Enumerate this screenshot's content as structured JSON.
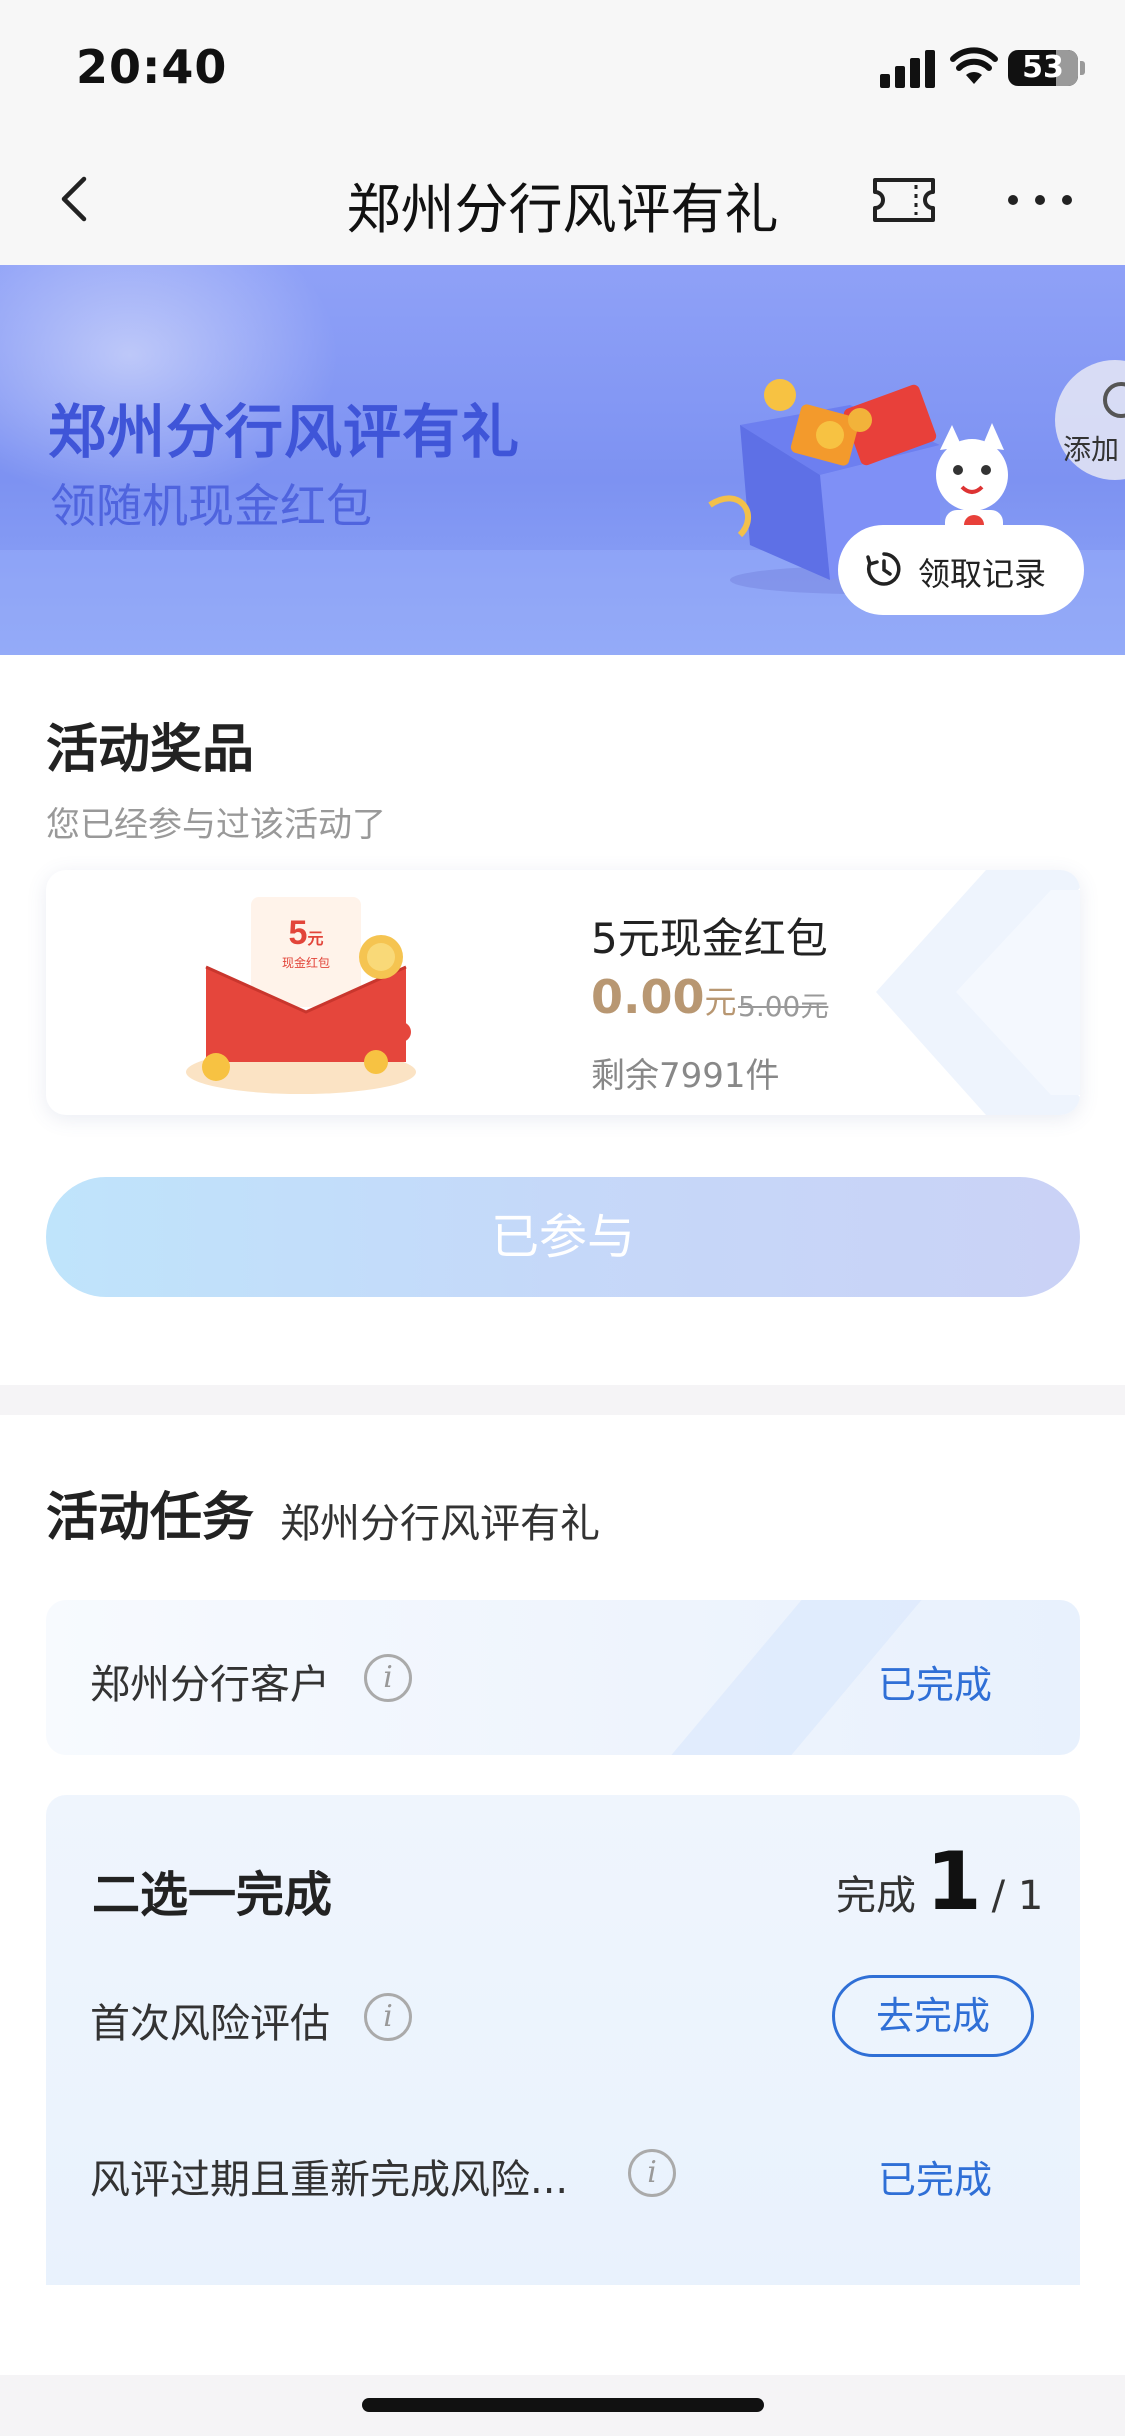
{
  "status_bar": {
    "time": "20:40",
    "battery": "53"
  },
  "nav": {
    "title": "郑州分行风评有礼"
  },
  "banner": {
    "title": "郑州分行风评有礼",
    "subtitle": "领随机现金红包",
    "add_label": "添加",
    "record_label": "领取记录"
  },
  "prize_section": {
    "title": "活动奖品",
    "note": "您已经参与过该活动了",
    "prize": {
      "image_text": "5元 现金红包",
      "name": "5元现金红包",
      "price": "0.00",
      "unit": "元",
      "original_price": "5.00元",
      "remaining": "剩余7991件"
    },
    "join_label": "已参与"
  },
  "task_section": {
    "title": "活动任务",
    "subtitle": "郑州分行风评有礼",
    "task1": {
      "label": "郑州分行客户",
      "status": "已完成"
    },
    "group": {
      "title": "二选一完成",
      "progress_label": "完成",
      "progress_done": "1",
      "progress_total": "/ 1",
      "items": [
        {
          "label": "首次风险评估",
          "action": "去完成"
        },
        {
          "label": "风评过期且重新完成风险...",
          "status": "已完成"
        }
      ]
    }
  },
  "colors": {
    "accent_blue": "#2f6fd6",
    "banner_title": "#3f55d8",
    "price_gold": "#b89772"
  },
  "icons": [
    "back-icon",
    "ticket-icon",
    "more-icon",
    "clock-icon",
    "info-icon"
  ]
}
